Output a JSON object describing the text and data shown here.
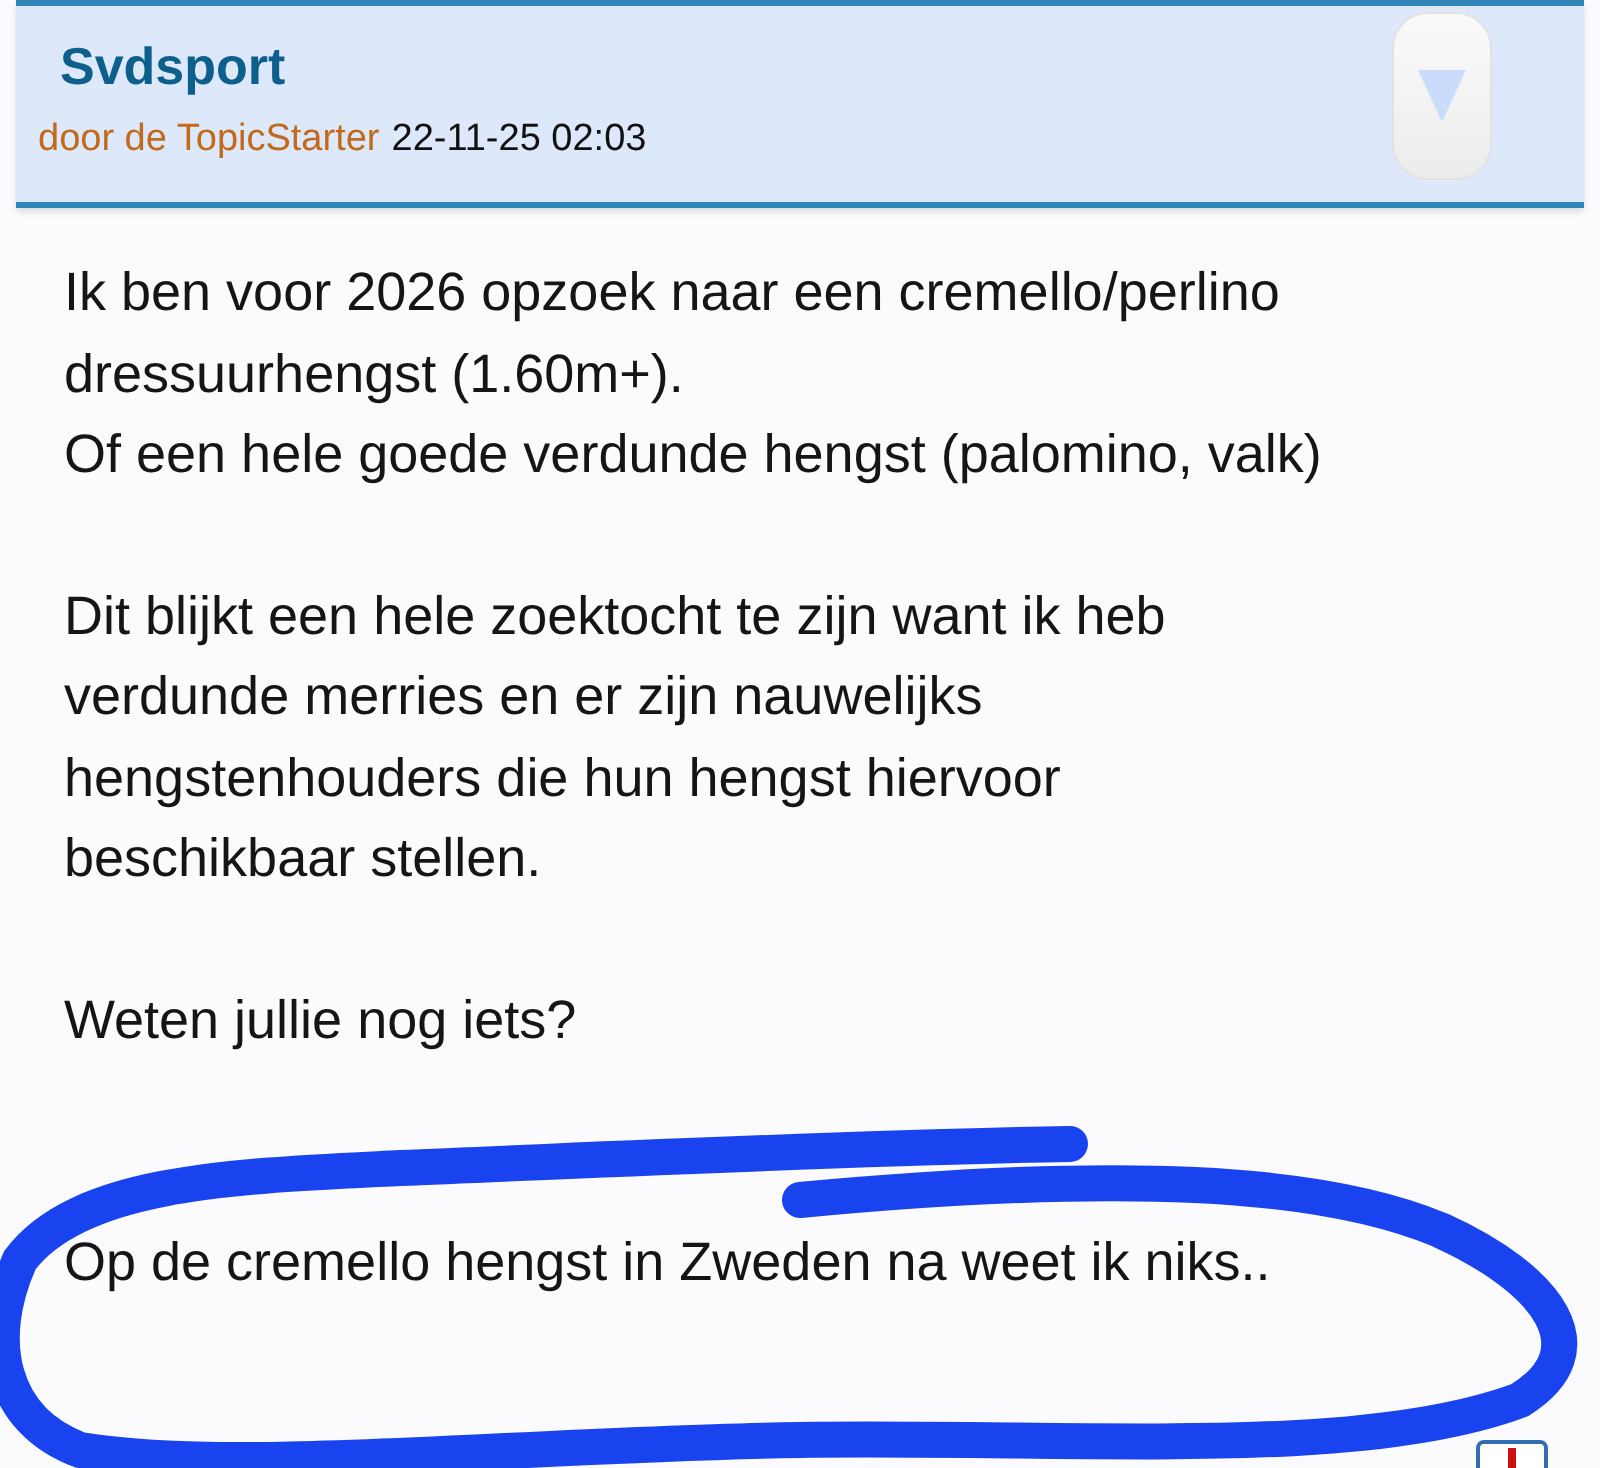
{
  "post": {
    "author": "Svdsport",
    "byline": "door de TopicStarter",
    "timestamp": "22-11-25 02:03",
    "paragraphs": [
      [
        "Ik ben voor 2026 opzoek naar een cremello/perlino",
        "dressuurhengst (1.60m+).",
        "Of een hele goede verdunde hengst (palomino, valk)"
      ],
      [
        "Dit blijkt een hele zoektocht te zijn want ik heb",
        "verdunde merries en er zijn nauwelijks",
        "hengstenhouders die hun hengst hiervoor",
        "beschikbaar stellen."
      ],
      [
        "Weten jullie nog iets?"
      ],
      [
        "Op de cremello hengst in Zweden na weet ik niks.."
      ]
    ]
  }
}
